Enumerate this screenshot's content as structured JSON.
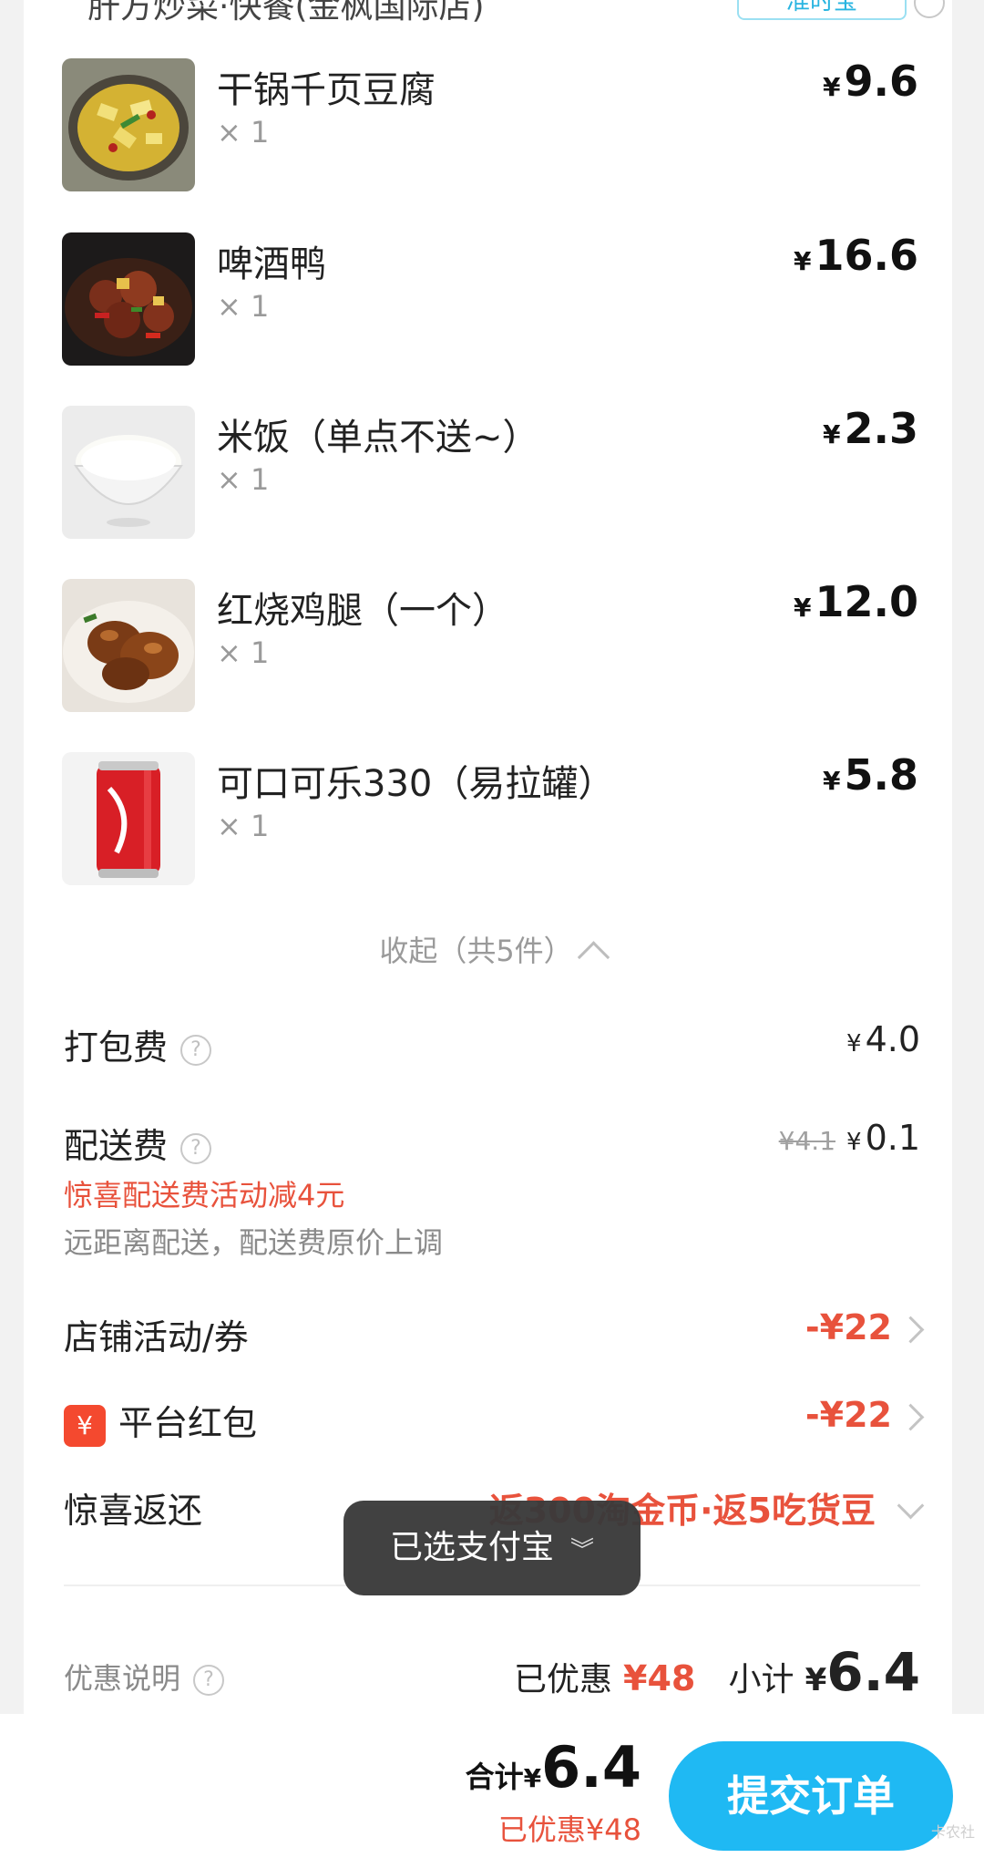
{
  "shop": {
    "name_partial": "肝方炒菜·快餐(金枫国际店)",
    "badge_partial": "准时宝"
  },
  "items": [
    {
      "name": "干锅千页豆腐",
      "qty": "× 1",
      "price": "9.6",
      "image": "dry-pot-tofu-photo"
    },
    {
      "name": "啤酒鸭",
      "qty": "× 1",
      "price": "16.6",
      "image": "beer-duck-photo"
    },
    {
      "name": "米饭（单点不送~）",
      "qty": "× 1",
      "price": "2.3",
      "image": "rice-bowl-photo"
    },
    {
      "name": "红烧鸡腿（一个）",
      "qty": "× 1",
      "price": "12.0",
      "image": "braised-chicken-leg-photo"
    },
    {
      "name": "可口可乐330（易拉罐）",
      "qty": "× 1",
      "price": "5.8",
      "image": "coca-cola-can-photo"
    }
  ],
  "currency": "¥",
  "collapse_label": "收起（共5件）",
  "fees": {
    "packaging": {
      "label": "打包费",
      "value": "4.0"
    },
    "delivery": {
      "label": "配送费",
      "original": "¥4.1",
      "value": "0.1",
      "promo": "惊喜配送费活动减4元",
      "note": "远距离配送，配送费原价上调"
    }
  },
  "discounts": {
    "shop": {
      "label": "店铺活动/券",
      "value": "-¥22"
    },
    "platform": {
      "label": "平台红包",
      "value": "-¥22",
      "icon": "yen-redpacket-icon"
    },
    "rebate": {
      "label": "惊喜返还",
      "value": "返300淘金币·返5吃货豆"
    }
  },
  "toast": {
    "text": "已选支付宝"
  },
  "summary": {
    "info_label": "优惠说明",
    "saved_label": "已优惠",
    "saved_value": "¥48",
    "subtotal_label": "小计",
    "subtotal_value": "6.4"
  },
  "footer": {
    "total_label": "合计",
    "total_value": "6.4",
    "saved_text": "已优惠¥48",
    "submit_label": "提交订单",
    "watermark": "卡农社"
  },
  "colors": {
    "accent": "#1fb9f3",
    "discount": "#e8523c"
  }
}
